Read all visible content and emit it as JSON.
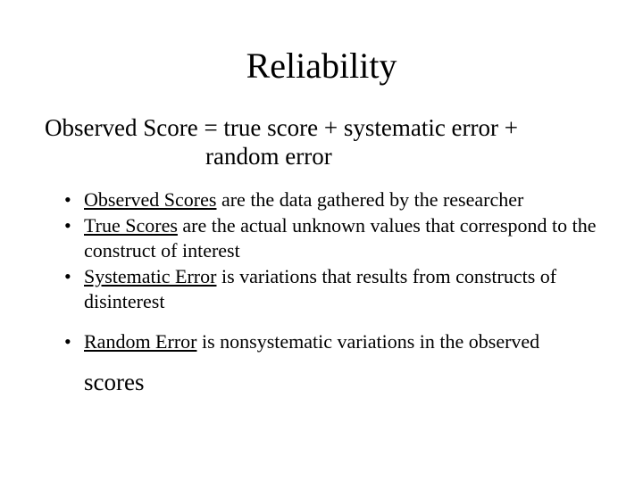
{
  "title": "Reliability",
  "equation": {
    "line1": "Observed Score = true score + systematic error +",
    "line2": "random error"
  },
  "bullets1": {
    "b1_u": "Observed Scores",
    "b1_rest": " are the data gathered by the researcher",
    "b2_u": "True Scores",
    "b2_rest": " are the actual unknown values that correspond to the construct of interest",
    "b3_u": "Systematic Error",
    "b3_rest": " is variations that results from constructs of disinterest"
  },
  "bullets2": {
    "b4_u": "Random Error",
    "b4_rest": " is nonsystematic variations in the observed",
    "scores": "scores"
  }
}
